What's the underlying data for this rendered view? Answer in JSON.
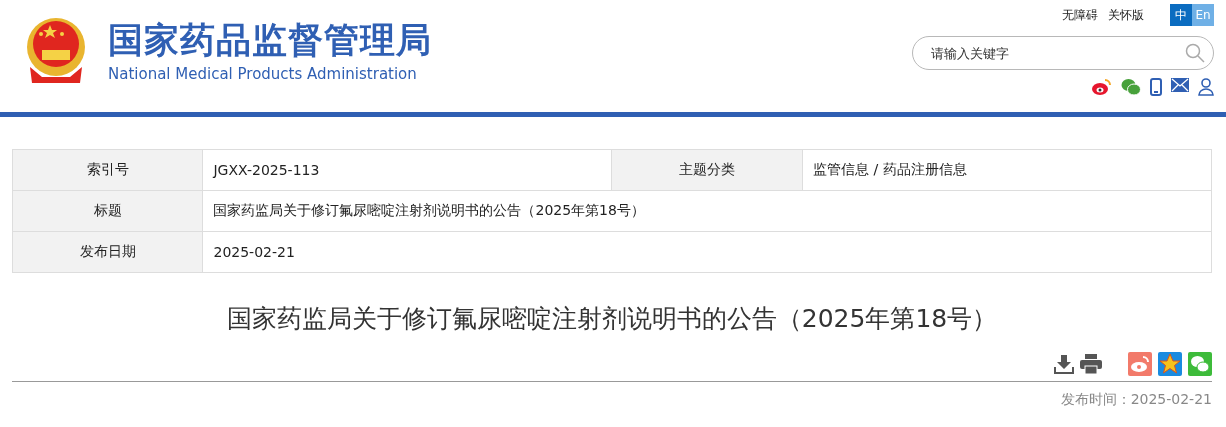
{
  "site": {
    "title_cn": "国家药品监督管理局",
    "title_en": "National Medical Products Administration"
  },
  "top_links": [
    "无障碍",
    "关怀版"
  ],
  "languages": [
    {
      "label": "中",
      "selected": true
    },
    {
      "label": "En",
      "selected": false
    }
  ],
  "search": {
    "placeholder": "请输入关键字"
  },
  "info_table": {
    "rows": [
      {
        "cells": [
          {
            "label": "索引号",
            "value": "JGXX-2025-113"
          },
          {
            "label": "主题分类",
            "value": "监管信息 / 药品注册信息"
          }
        ]
      },
      {
        "cells": [
          {
            "label": "标题",
            "value": "国家药监局关于修订氟尿嘧啶注射剂说明书的公告（2025年第18号）"
          }
        ]
      },
      {
        "cells": [
          {
            "label": "发布日期",
            "value": "2025-02-21"
          }
        ]
      }
    ]
  },
  "article": {
    "title": "国家药监局关于修订氟尿嘧啶注射剂说明书的公告（2025年第18号）",
    "publish_label": "发布时间：",
    "publish_date": "2025-02-21"
  }
}
